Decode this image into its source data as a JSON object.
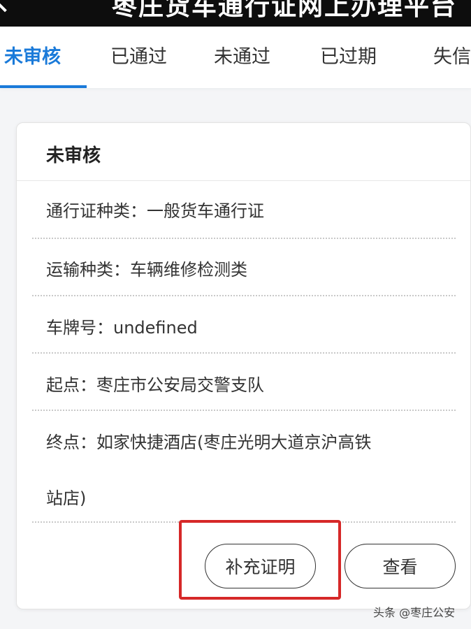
{
  "header": {
    "title": "枣庄货车通行证网上办理平台"
  },
  "tabs": [
    {
      "label": "未审核",
      "active": true
    },
    {
      "label": "已通过",
      "active": false
    },
    {
      "label": "未通过",
      "active": false
    },
    {
      "label": "已过期",
      "active": false
    },
    {
      "label": "失信",
      "active": false
    }
  ],
  "card": {
    "title": "未审核",
    "fields": {
      "pass_type": "通行证种类：一般货车通行证",
      "transport_type": "运输种类：车辆维修检测类",
      "plate": "车牌号：undefined",
      "origin": "起点：枣庄市公安局交警支队",
      "destination_line1": "终点：如家快捷酒店(枣庄光明大道京沪高铁",
      "destination_line2": "站店)"
    },
    "buttons": {
      "supplement": "补充证明",
      "view": "查看"
    }
  },
  "watermark": "头条 @枣庄公安",
  "colors": {
    "accent": "#1a7ad9",
    "highlight": "#d62828"
  }
}
